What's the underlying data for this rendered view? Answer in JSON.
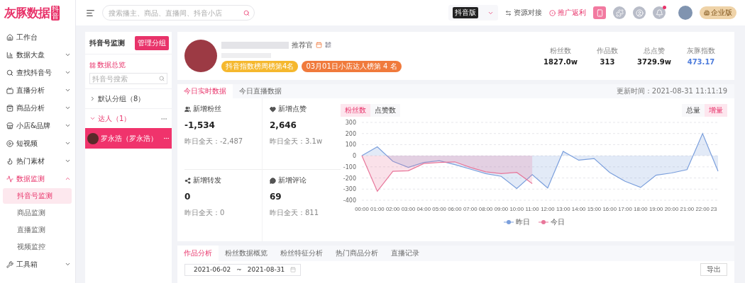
{
  "header": {
    "logo": "灰豚数据",
    "logo_sub": "抖音",
    "search": {
      "placeholder": "搜索播主、商品、直播间、抖音小店"
    },
    "platform": "抖音版",
    "links": [
      {
        "label": "资源对接",
        "kind": "plain"
      },
      {
        "label": "推广返利",
        "kind": "accent"
      }
    ],
    "notification_dot": true,
    "plan": "企业版"
  },
  "sidebar": {
    "items": [
      {
        "label": "工作台",
        "selected": false
      },
      {
        "label": "数据大盘",
        "selected": false,
        "expanded": false
      },
      {
        "label": "查找抖音号",
        "selected": false,
        "expanded": false
      },
      {
        "label": "直播分析",
        "selected": false,
        "expanded": false
      },
      {
        "label": "商品分析",
        "selected": false,
        "expanded": false
      },
      {
        "label": "小店&品牌",
        "selected": false,
        "expanded": false
      },
      {
        "label": "短视频",
        "selected": false,
        "expanded": false
      },
      {
        "label": "热门素材",
        "selected": false,
        "expanded": false
      },
      {
        "label": "数据监测",
        "selected": true,
        "expanded": true,
        "children": [
          {
            "label": "抖音号监测",
            "selected": true
          },
          {
            "label": "商品监测",
            "selected": false
          },
          {
            "label": "直播监测",
            "selected": false
          },
          {
            "label": "视频监控",
            "selected": false
          }
        ]
      },
      {
        "label": "工具箱",
        "selected": false,
        "expanded": false
      }
    ]
  },
  "monitor_panel": {
    "title": "抖音号监测",
    "manage_button": "管理分组",
    "overview": "数据总览",
    "search": {
      "placeholder": "抖音号搜索"
    },
    "groups": [
      {
        "label": "默认分组（8）",
        "expanded": false
      },
      {
        "label": "达人（1）",
        "expanded": true,
        "children": [
          {
            "label": "罗永浩（罗永浩）",
            "selected": true
          }
        ]
      }
    ]
  },
  "profile": {
    "role": "推荐官",
    "badges": [
      {
        "label": "抖音指数榜周榜第4名",
        "color": "#f5b82e"
      },
      {
        "label": "03月01日小店达人榜第 4 名",
        "color": "#f07a3c"
      }
    ],
    "stats": [
      {
        "label": "粉丝数",
        "value": "1827.0w",
        "highlight": false
      },
      {
        "label": "作品数",
        "value": "313",
        "highlight": false
      },
      {
        "label": "总点赞",
        "value": "3729.9w",
        "highlight": false
      },
      {
        "label": "灰豚指数",
        "value": "473.17",
        "highlight": true
      }
    ]
  },
  "realtime": {
    "tabs": [
      {
        "label": "今日实时数据",
        "selected": true
      },
      {
        "label": "今日直播数据",
        "selected": false
      }
    ],
    "updated": "更新时间：2021-08-31 11:11:19",
    "metrics": [
      {
        "kind": "fans",
        "label": "新增粉丝",
        "value": "-1,534",
        "yesterday": "昨日全天：-2,487"
      },
      {
        "kind": "likes",
        "label": "新增点赞",
        "value": "2,646",
        "yesterday": "昨日全天：3.1w"
      },
      {
        "kind": "shares",
        "label": "新增转发",
        "value": "0",
        "yesterday": "昨日全天：0"
      },
      {
        "kind": "comments",
        "label": "新增评论",
        "value": "69",
        "yesterday": "昨日全天：811"
      }
    ],
    "metric_toggle": [
      {
        "label": "粉丝数",
        "selected": true
      },
      {
        "label": "点赞数",
        "selected": false
      }
    ],
    "mode_toggle": [
      {
        "label": "总量",
        "selected": false
      },
      {
        "label": "增量",
        "selected": true
      }
    ],
    "chart_data": {
      "type": "area",
      "grid": true,
      "categories": [
        "00:00",
        "01:00",
        "02:00",
        "03:00",
        "04:00",
        "05:00",
        "06:00",
        "07:00",
        "08:00",
        "09:00",
        "10:00",
        "11:00",
        "12:00",
        "13:00",
        "14:00",
        "15:00",
        "16:00",
        "17:00",
        "18:00",
        "19:00",
        "20:00",
        "21:00",
        "22:00",
        "23"
      ],
      "ylim": [
        -400,
        300
      ],
      "yticks": [
        300,
        200,
        100,
        0,
        -100,
        -200,
        -300,
        -400
      ],
      "series": [
        {
          "name": "昨日",
          "color": "#7b9fdc",
          "values": [
            0,
            80,
            -50,
            -105,
            -60,
            -45,
            -80,
            -120,
            -160,
            -185,
            -295,
            -170,
            -290,
            40,
            -40,
            -25,
            -150,
            -230,
            -285,
            -175,
            -155,
            -125,
            200,
            -140
          ]
        },
        {
          "name": "今日",
          "color": "#e8769a",
          "values": [
            0,
            -320,
            -140,
            -135,
            -70,
            -60,
            -55,
            -105,
            -145,
            -160,
            -150,
            -250,
            null,
            null,
            null,
            null,
            null,
            null,
            null,
            null,
            null,
            null,
            null,
            null
          ]
        }
      ]
    }
  },
  "analysis": {
    "tabs": [
      {
        "label": "作品分析",
        "selected": true
      },
      {
        "label": "粉丝数据概览",
        "selected": false
      },
      {
        "label": "粉丝特征分析",
        "selected": false
      },
      {
        "label": "热门商品分析",
        "selected": false
      },
      {
        "label": "直播记录",
        "selected": false
      }
    ],
    "date_from": "2021-06-02",
    "date_sep": "~",
    "date_to": "2021-08-31",
    "export_button": "导出"
  }
}
